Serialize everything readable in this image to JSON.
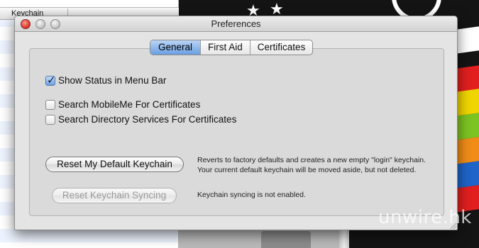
{
  "background": {
    "left_column_header": "Keychain",
    "watermark": "unwire.hk",
    "stripe_colors": [
      "#e11f1f",
      "#f0d500",
      "#7cc422",
      "#f08c17",
      "#1f64c8",
      "#e11f1f",
      "#ffffff"
    ]
  },
  "window": {
    "title": "Preferences",
    "tabs": [
      {
        "label": "General",
        "active": true
      },
      {
        "label": "First Aid",
        "active": false
      },
      {
        "label": "Certificates",
        "active": false
      }
    ],
    "checkboxes": [
      {
        "label": "Show Status in Menu Bar",
        "checked": true
      },
      {
        "label": "Search MobileMe For Certificates",
        "checked": false
      },
      {
        "label": "Search Directory Services For Certificates",
        "checked": false
      }
    ],
    "reset_default": {
      "label": "Reset My Default Keychain",
      "description_line1": "Reverts to factory defaults and creates a new empty \"login\" keychain.",
      "description_line2": "Your current default keychain will be moved aside, but not deleted."
    },
    "reset_sync": {
      "label": "Reset Keychain Syncing",
      "enabled": false,
      "description": "Keychain syncing is not enabled."
    }
  },
  "colors": {
    "tab_active": "#6a9fe2",
    "close_button": "#e0443a"
  }
}
